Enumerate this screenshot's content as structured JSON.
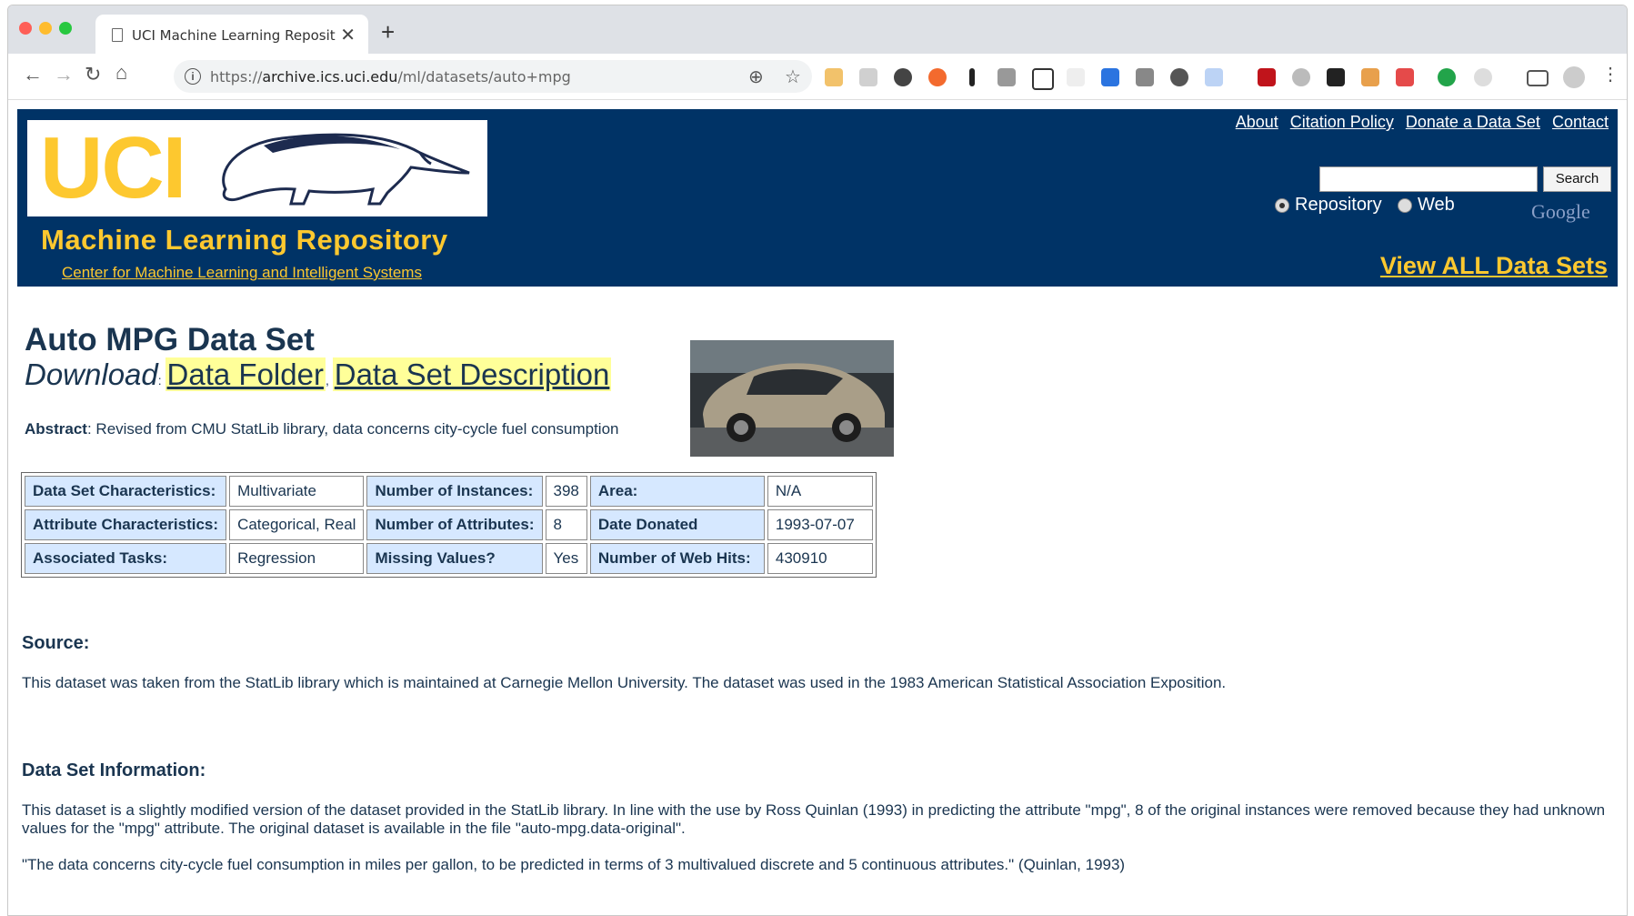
{
  "browser": {
    "tab_title": "UCI Machine Learning Repositor",
    "tab_close": "✕",
    "new_tab": "+",
    "url_prefix": "https://",
    "url_host": "archive.ics.uci.edu",
    "url_path": "/ml/datasets/auto+mpg"
  },
  "header": {
    "logo_text": "UCI",
    "repo_title": "Machine Learning Repository",
    "center_link": "Center for Machine Learning and Intelligent Systems",
    "links": [
      "About",
      "Citation Policy",
      "Donate a Data Set",
      "Contact"
    ],
    "search_button": "Search",
    "search_value": "",
    "radio_repository": "Repository",
    "radio_web": "Web",
    "google_text": "Google",
    "view_all": "View ALL Data Sets"
  },
  "dataset": {
    "title": "Auto MPG Data Set",
    "download_label": "Download",
    "download_links": [
      "Data Folder",
      "Data Set Description"
    ],
    "abstract_label": "Abstract",
    "abstract_text": ": Revised from CMU StatLib library, data concerns city-cycle fuel consumption",
    "rows": [
      [
        "Data Set Characteristics:",
        "Multivariate",
        "Number of Instances:",
        "398",
        "Area:",
        "N/A"
      ],
      [
        "Attribute Characteristics:",
        "Categorical, Real",
        "Number of Attributes:",
        "8",
        "Date Donated",
        "1993-07-07"
      ],
      [
        "Associated Tasks:",
        "Regression",
        "Missing Values?",
        "Yes",
        "Number of Web Hits:",
        "430910"
      ]
    ]
  },
  "source": {
    "heading": "Source:",
    "text": "This dataset was taken from the StatLib library which is maintained at Carnegie Mellon University. The dataset was used in the 1983 American Statistical Association Exposition."
  },
  "info": {
    "heading": "Data Set Information:",
    "para1": "This dataset is a slightly modified version of the dataset provided in the StatLib library. In line with the use by Ross Quinlan (1993) in predicting the attribute \"mpg\", 8 of the original instances were removed because they had unknown values for the \"mpg\" attribute. The original dataset is available in the file \"auto-mpg.data-original\".",
    "para2": "\"The data concerns city-cycle fuel consumption in miles per gallon, to be predicted in terms of 3 multivalued discrete and 5 continuous attributes.\" (Quinlan, 1993)"
  },
  "colors": {
    "uci_blue": "#003366",
    "uci_gold": "#fdc82f",
    "cell_header": "#d6e8ff",
    "highlight": "#ffff99"
  }
}
